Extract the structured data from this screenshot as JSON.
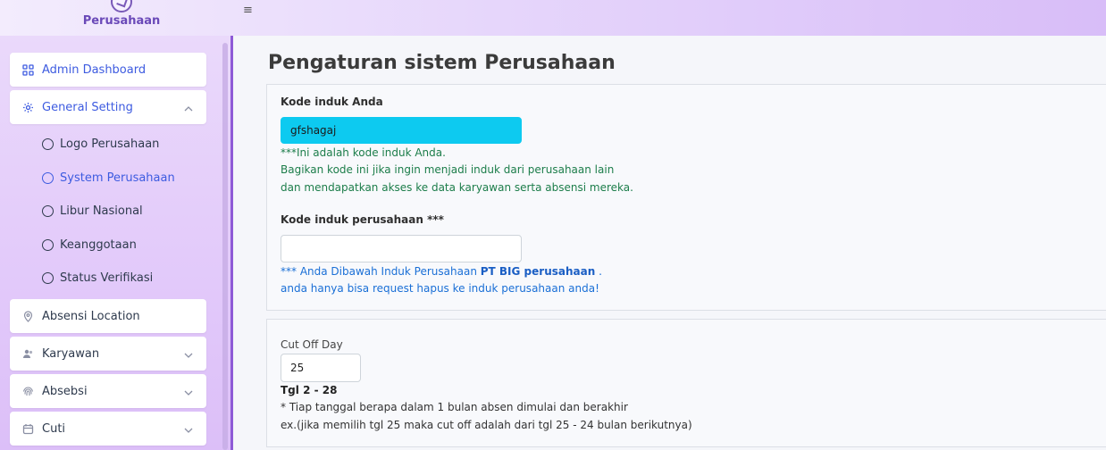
{
  "brand": {
    "name": "Perusahaan",
    "logo_icon": "clock-check-icon"
  },
  "topbar": {
    "menu_icon": "≡"
  },
  "sidebar": {
    "items": [
      {
        "label": "Admin Dashboard",
        "icon": "grid-icon"
      },
      {
        "label": "General Setting",
        "icon": "gear-icon",
        "expanded": true
      },
      {
        "label": "Absensi Location",
        "icon": "location-pin-icon"
      },
      {
        "label": "Karyawan",
        "icon": "users-icon"
      },
      {
        "label": "Absebsi",
        "icon": "fingerprint-icon"
      },
      {
        "label": "Cuti",
        "icon": "calendar-icon"
      }
    ],
    "sub_items": [
      {
        "label": "Logo Perusahaan"
      },
      {
        "label": "System Perusahaan",
        "active": true
      },
      {
        "label": "Libur Nasional"
      },
      {
        "label": "Keanggotaan"
      },
      {
        "label": "Status Verifikasi"
      }
    ]
  },
  "page": {
    "title": "Pengaturan sistem Perusahaan"
  },
  "kode_induk": {
    "label": "Kode induk Anda",
    "value": "gfshagaj",
    "note1": "***Ini adalah kode induk Anda.",
    "note2": "Bagikan kode ini jika ingin menjadi induk dari perusahaan lain",
    "note3": "dan mendapatkan akses ke data karyawan serta absensi mereka."
  },
  "kode_induk_perusahaan": {
    "label": "Kode induk perusahaan ***",
    "value": "",
    "note_prefix": "*** Anda Dibawah Induk Perusahaan ",
    "note_company": "PT BIG perusahaan",
    "note_suffix": " .",
    "note2": "anda hanya bisa request hapus ke induk perusahaan anda!"
  },
  "cut_off": {
    "label": "Cut Off Day",
    "value": "25",
    "range": "Tgl 2 - 28",
    "note1": "* Tiap tanggal berapa dalam 1 bulan absen dimulai dan berakhir",
    "note2": "ex.(jika memilih tgl 25 maka cut off adalah dari tgl 25 - 24 bulan berikutnya)"
  },
  "colors": {
    "accent": "#3d5be0",
    "cyan_input": "#0dcaf0",
    "sidebar_border": "#8e5ad6"
  }
}
